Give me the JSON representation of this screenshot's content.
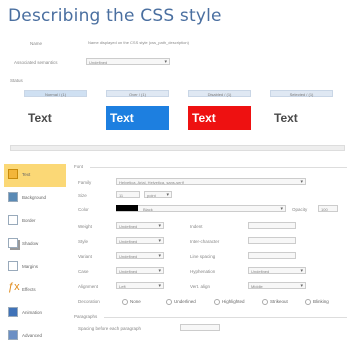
{
  "header": {
    "title": "Describing the CSS style"
  },
  "top": {
    "name_label": "Name",
    "name_value": "Name displayed on the CSS style (css_path_description)",
    "assoc_label": "Associated semantics",
    "assoc_value": "Undefined"
  },
  "status": {
    "label": "Status",
    "tabs": [
      {
        "label": "Normal / (1)"
      },
      {
        "label": "Over / (1)"
      },
      {
        "label": "Disabled / (1)"
      },
      {
        "label": "Selected / (1)"
      }
    ],
    "previews": [
      {
        "text": "Text",
        "bg": "#ffffff",
        "fg": "#4a4a4a"
      },
      {
        "text": "Text",
        "bg": "#1d7fe0",
        "fg": "#ffffff"
      },
      {
        "text": "Text",
        "bg": "#ee1111",
        "fg": "#ffffff"
      },
      {
        "text": "Text",
        "bg": "#ffffff",
        "fg": "#4a4a4a"
      }
    ]
  },
  "sidebar": {
    "items": [
      {
        "label": "Text",
        "icon": "text-icon",
        "active": true
      },
      {
        "label": "Background",
        "icon": "background-icon"
      },
      {
        "label": "Border",
        "icon": "border-icon"
      },
      {
        "label": "Shadow",
        "icon": "shadow-icon"
      },
      {
        "label": "Margins",
        "icon": "margins-icon"
      },
      {
        "label": "Effects",
        "icon": "effects-icon"
      },
      {
        "label": "Animation",
        "icon": "animation-icon"
      },
      {
        "label": "Advanced",
        "icon": "advanced-icon"
      }
    ]
  },
  "font": {
    "legend": "Font",
    "family_label": "Family",
    "family_value": "Helvetica, Arial, Helvetica, sans-serif",
    "size_label": "Size",
    "size_value": "11",
    "size_unit": "point",
    "color_label": "Color",
    "color_value": "Black",
    "color_hex": "#000000",
    "opacity_label": "Opacity",
    "opacity_value": "100",
    "weight_label": "Weight",
    "weight_value": "Undefined",
    "style_label": "Style",
    "style_value": "Undefined",
    "variant_label": "Variant",
    "variant_value": "Undefined",
    "case_label": "Case",
    "case_value": "Undefined",
    "alignment_label": "Alignment",
    "alignment_value": "Left",
    "indent_label": "Indent",
    "interchar_label": "Inter-character",
    "line_label": "Line spacing",
    "wrap_label": "Wrap",
    "hyphenation_label": "Hyphenation",
    "hyphenation_value": "Undefined",
    "valign_label": "Vert. align",
    "valign_value": "Middle",
    "decoration_label": "Decoration",
    "decoration_options": [
      "None",
      "Underlined",
      "Highlighted",
      "Strikeout",
      "Blinking"
    ]
  },
  "paragraphs": {
    "legend": "Paragraphs",
    "spacing_label": "Spacing before each paragraph"
  }
}
